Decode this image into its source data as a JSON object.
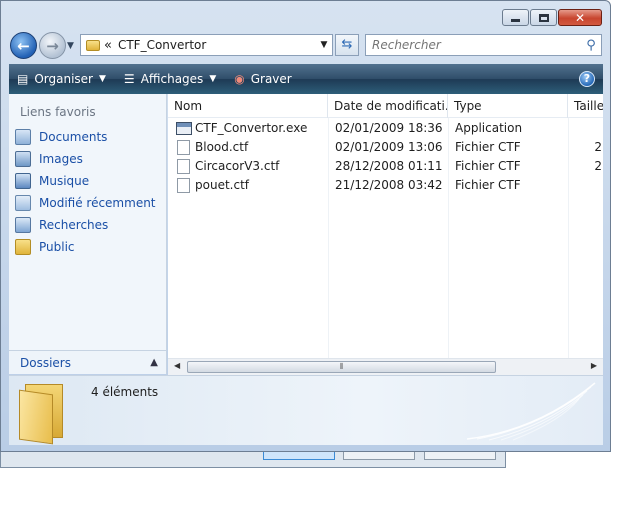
{
  "window": {
    "address": {
      "chevron": "«",
      "path": "CTF_Convertor"
    },
    "search": {
      "placeholder": "Rechercher"
    }
  },
  "toolbar": {
    "organize_label": "Organiser",
    "views_label": "Affichages",
    "burn_label": "Graver"
  },
  "sidebar": {
    "header": "Liens favoris",
    "items": [
      {
        "label": "Documents",
        "icon": "documents-icon"
      },
      {
        "label": "Images",
        "icon": "pictures-icon"
      },
      {
        "label": "Musique",
        "icon": "music-icon"
      },
      {
        "label": "Modifié récemment",
        "icon": "recent-icon"
      },
      {
        "label": "Recherches",
        "icon": "searches-icon"
      },
      {
        "label": "Public",
        "icon": "public-folder-icon"
      }
    ],
    "folders_label": "Dossiers"
  },
  "file_list": {
    "columns": [
      "Nom",
      "Date de modificati...",
      "Type",
      "Taille"
    ],
    "rows": [
      {
        "name": "CTF_Convertor.exe",
        "date": "02/01/2009 18:36",
        "type": "Application",
        "size": "",
        "icon": "application-icon"
      },
      {
        "name": "Blood.ctf",
        "date": "02/01/2009 13:06",
        "type": "Fichier CTF",
        "size": "2",
        "icon": "file-icon"
      },
      {
        "name": "CircacorV3.ctf",
        "date": "28/12/2008 01:11",
        "type": "Fichier CTF",
        "size": "2",
        "icon": "file-icon"
      },
      {
        "name": "pouet.ctf",
        "date": "21/12/2008 03:42",
        "type": "Fichier CTF",
        "size": "",
        "icon": "file-icon"
      }
    ]
  },
  "details": {
    "count_text": "4 éléments"
  }
}
